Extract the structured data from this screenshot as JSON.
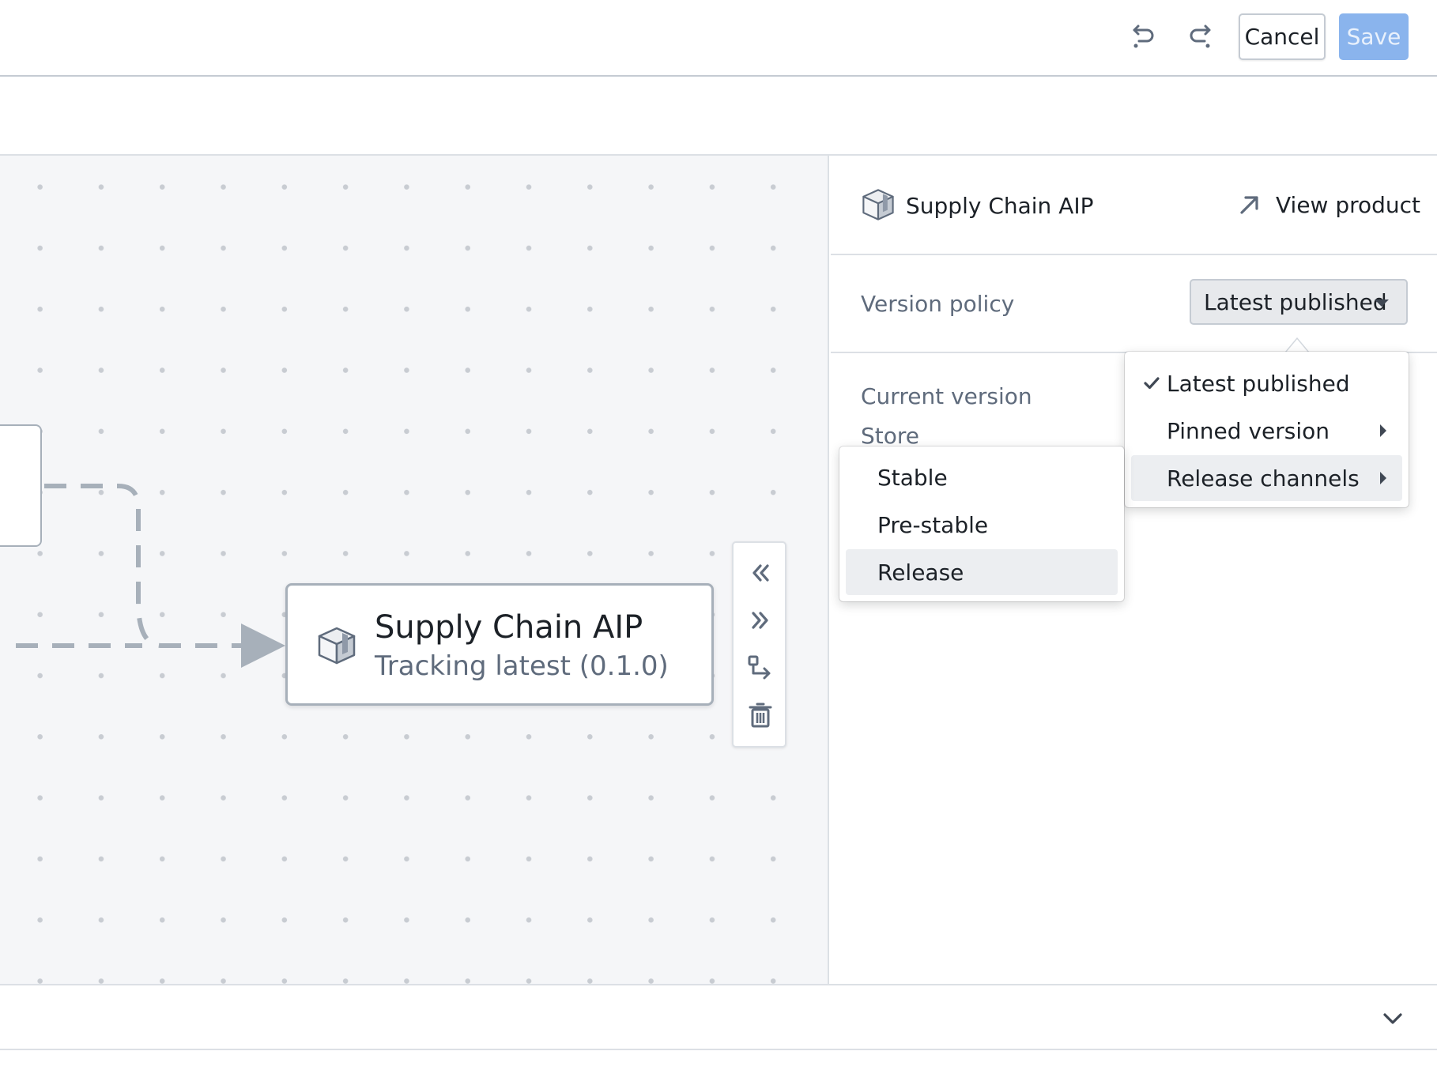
{
  "toolbar": {
    "undo_icon": "undo-icon",
    "redo_icon": "redo-icon",
    "cancel_label": "Cancel",
    "save_label": "Save",
    "save_color": "#8ab4ed"
  },
  "canvas": {
    "node": {
      "title": "Supply Chain AIP",
      "subtitle": "Tracking latest (0.1.0)",
      "icon": "cube-icon"
    },
    "tools": [
      {
        "name": "collapse-left-icon"
      },
      {
        "name": "expand-right-icon"
      },
      {
        "name": "route-icon"
      },
      {
        "name": "trash-icon"
      }
    ]
  },
  "panel": {
    "product_title": "Supply Chain AIP",
    "view_product_label": "View product",
    "version_policy_label": "Version policy",
    "version_policy_value": "Latest published",
    "current_version_label": "Current version",
    "store_label": "Store"
  },
  "policy_menu": {
    "items": [
      {
        "label": "Latest published",
        "checked": true,
        "submenu": false
      },
      {
        "label": "Pinned version",
        "checked": false,
        "submenu": true
      },
      {
        "label": "Release channels",
        "checked": false,
        "submenu": true,
        "active": true
      }
    ]
  },
  "channels_menu": {
    "items": [
      {
        "label": "Stable"
      },
      {
        "label": "Pre-stable"
      },
      {
        "label": "Release",
        "active": true
      }
    ]
  },
  "colors": {
    "accent": "#2d72d2",
    "border": "#c5cbd3",
    "muted_text": "#5f6b7c",
    "edge": "#a7b0ba"
  }
}
